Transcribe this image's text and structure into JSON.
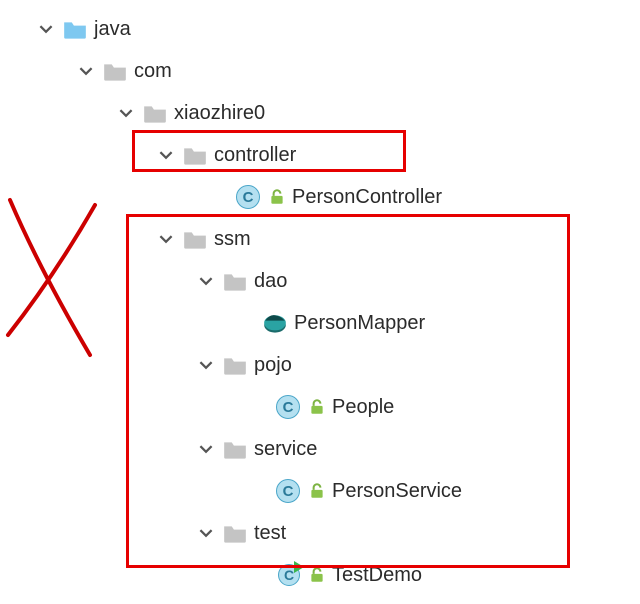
{
  "tree": {
    "java": "java",
    "com": "com",
    "xiaozhire0": "xiaozhire0",
    "controller": "controller",
    "personController": "PersonController",
    "ssm": "ssm",
    "dao": "dao",
    "personMapper": "PersonMapper",
    "pojo": "pojo",
    "people": "People",
    "service": "service",
    "personService": "PersonService",
    "test": "test",
    "testDemo": "TestDemo"
  },
  "classLetter": "C",
  "annotations": {
    "redBox1": "controller-highlight",
    "redBox2": "ssm-highlight",
    "xMark": "x-annotation"
  },
  "colors": {
    "highlight": "#e60000",
    "folderBlue": "#7ec8f0",
    "folderGrey": "#c4c4c4",
    "classBg": "#b4e0f0"
  }
}
